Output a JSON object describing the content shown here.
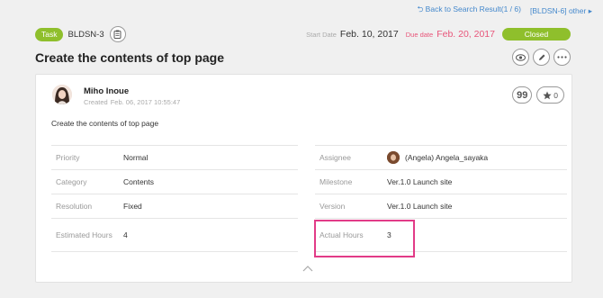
{
  "topnav": {
    "back_text": "Back to Search Result(1 / 6)",
    "other_text": "[BLDSN-6] other"
  },
  "header": {
    "type_badge": "Task",
    "issue_key": "BLDSN-3",
    "start_label": "Start Date",
    "start_value": "Feb. 10, 2017",
    "due_label": "Due date",
    "due_value": "Feb. 20, 2017",
    "status": "Closed"
  },
  "title": "Create the contents of top page",
  "card": {
    "author": "Miho Inoue",
    "created_label": "Created",
    "created_value": "Feb. 06, 2017 10:55:47",
    "quote_glyph": "99",
    "star_count": "0",
    "description": "Create the contents of top page"
  },
  "fields_left": [
    {
      "label": "Priority",
      "value": "Normal"
    },
    {
      "label": "Category",
      "value": "Contents"
    },
    {
      "label": "Resolution",
      "value": "Fixed"
    },
    {
      "label": "Estimated Hours",
      "value": "4"
    }
  ],
  "fields_right": [
    {
      "label": "Assignee",
      "value": "(Angela) Angela_sayaka"
    },
    {
      "label": "Milestone",
      "value": "Ver.1.0 Launch site"
    },
    {
      "label": "Version",
      "value": "Ver.1.0 Launch site"
    },
    {
      "label": "Actual Hours",
      "value": "3"
    }
  ],
  "colors": {
    "accent_green": "#8fbf2c",
    "due_red": "#e8557a",
    "highlight": "#e23b87",
    "link": "#4488cc"
  },
  "icons": [
    "back-arrow-icon",
    "triangle-right-icon",
    "clipboard-icon",
    "eye-icon",
    "pencil-icon",
    "more-icon",
    "quote-icon",
    "star-icon",
    "chevron-up-icon"
  ]
}
